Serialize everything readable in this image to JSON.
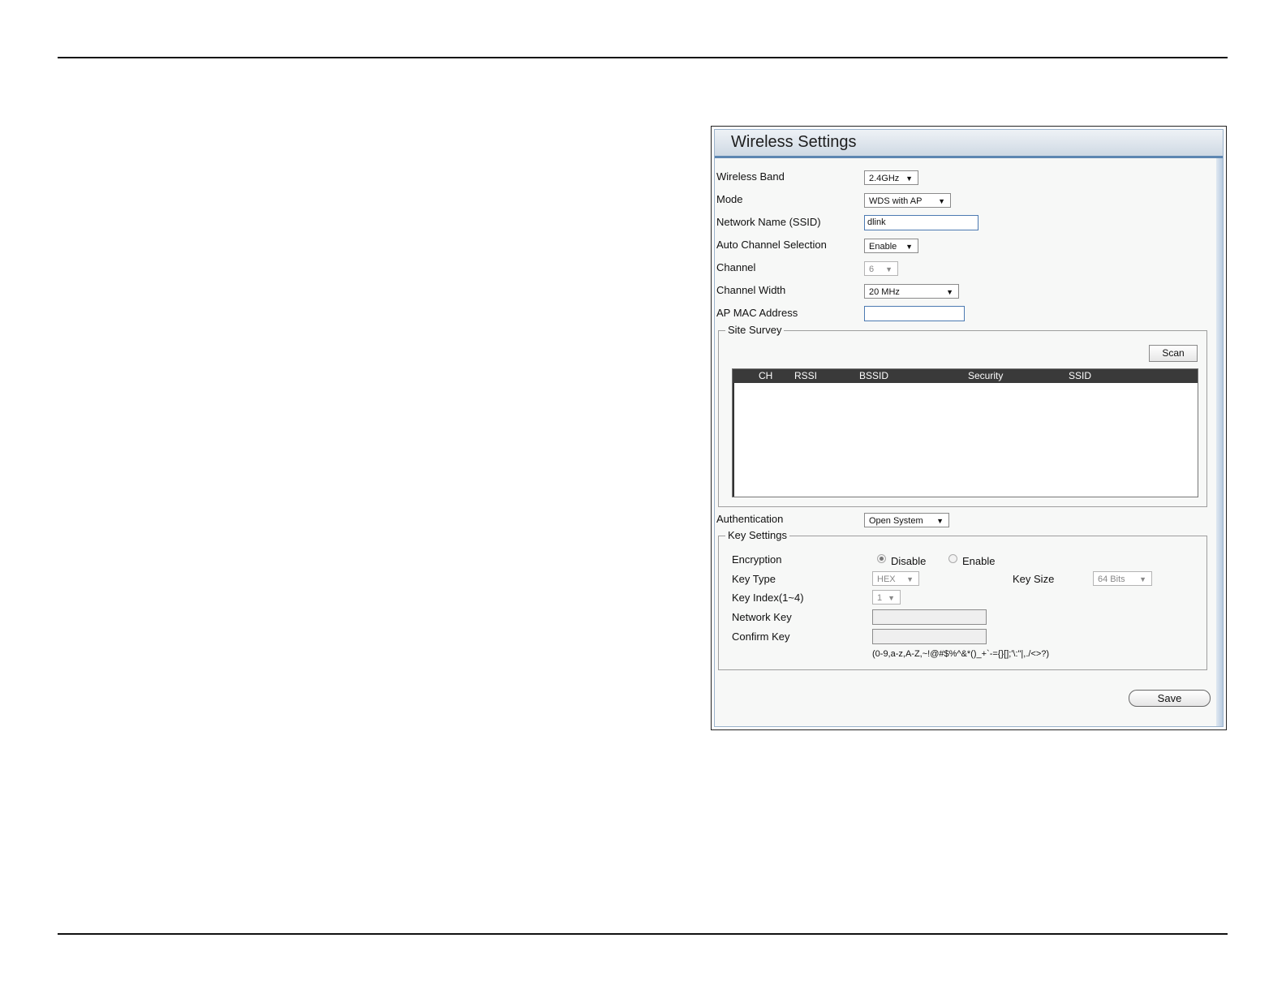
{
  "panel": {
    "title": "Wireless Settings",
    "fields": {
      "wireless_band": {
        "label": "Wireless Band",
        "value": "2.4GHz"
      },
      "mode": {
        "label": "Mode",
        "value": "WDS with AP"
      },
      "ssid": {
        "label": "Network Name (SSID)",
        "value": "dlink"
      },
      "auto_channel": {
        "label": "Auto Channel Selection",
        "value": "Enable"
      },
      "channel": {
        "label": "Channel",
        "value": "6"
      },
      "channel_width": {
        "label": "Channel Width",
        "value": "20 MHz"
      },
      "ap_mac": {
        "label": "AP MAC Address",
        "value": ""
      },
      "authentication": {
        "label": "Authentication",
        "value": "Open System"
      }
    },
    "site_survey": {
      "legend": "Site Survey",
      "scan_label": "Scan",
      "columns": [
        "CH",
        "RSSI",
        "BSSID",
        "Security",
        "SSID"
      ]
    },
    "key_settings": {
      "legend": "Key Settings",
      "encryption_label": "Encryption",
      "disable_label": "Disable",
      "enable_label": "Enable",
      "key_type_label": "Key Type",
      "key_type_value": "HEX",
      "key_size_label": "Key Size",
      "key_size_value": "64 Bits",
      "key_index_label": "Key Index(1~4)",
      "key_index_value": "1",
      "network_key_label": "Network Key",
      "confirm_key_label": "Confirm Key",
      "hint": "(0-9,a-z,A-Z,~!@#$%^&*()_+`-={}[];'\\:\"|,./<>?)"
    },
    "save_label": "Save",
    "arrow": "▼"
  }
}
